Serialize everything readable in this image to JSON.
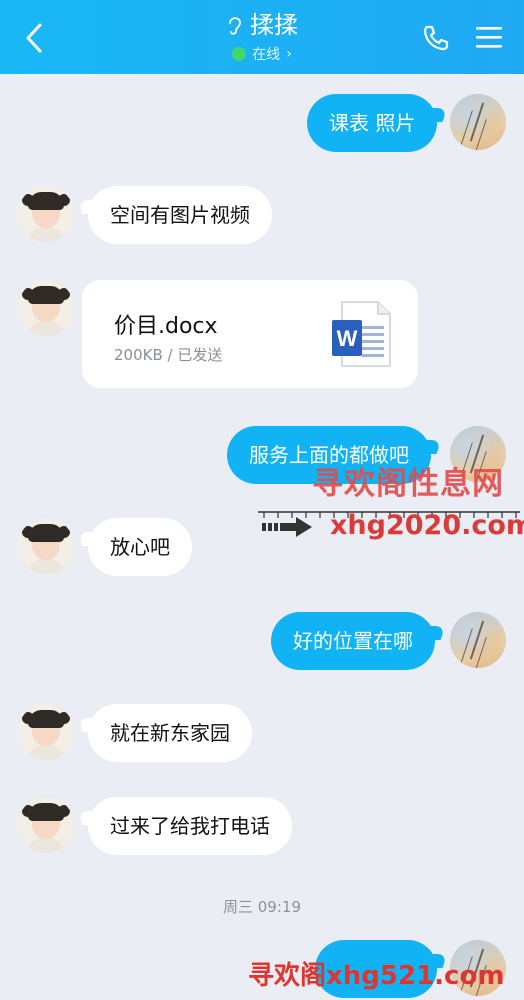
{
  "header": {
    "contact_name": "揉揉",
    "status": "在线",
    "status_chevron": "›"
  },
  "messages": [
    {
      "sender": "me",
      "text": "课表 照片"
    },
    {
      "sender": "them",
      "text": "空间有图片视频"
    },
    {
      "sender": "them",
      "type": "file",
      "file_name": "价目.docx",
      "file_meta": "200KB / 已发送",
      "file_icon_letter": "W"
    },
    {
      "sender": "me",
      "text": "服务上面的都做吧"
    },
    {
      "sender": "them",
      "text": "放心吧"
    },
    {
      "sender": "me",
      "text": "好的位置在哪"
    },
    {
      "sender": "them",
      "text": "就在新东家园"
    },
    {
      "sender": "them",
      "text": "过来了给我打电话"
    },
    {
      "sender": "me",
      "text": ""
    }
  ],
  "timestamp": "周三 09:19",
  "watermarks": {
    "line1": "寻欢阁性息网",
    "line2": "xhg2020.com",
    "line3": "寻欢阁xhg521.com"
  },
  "colors": {
    "header": "#1ab4f5",
    "bubble_me": "#12b3f4",
    "bubble_them": "#ffffff",
    "background": "#eaedf4",
    "online": "#3fd96b"
  }
}
